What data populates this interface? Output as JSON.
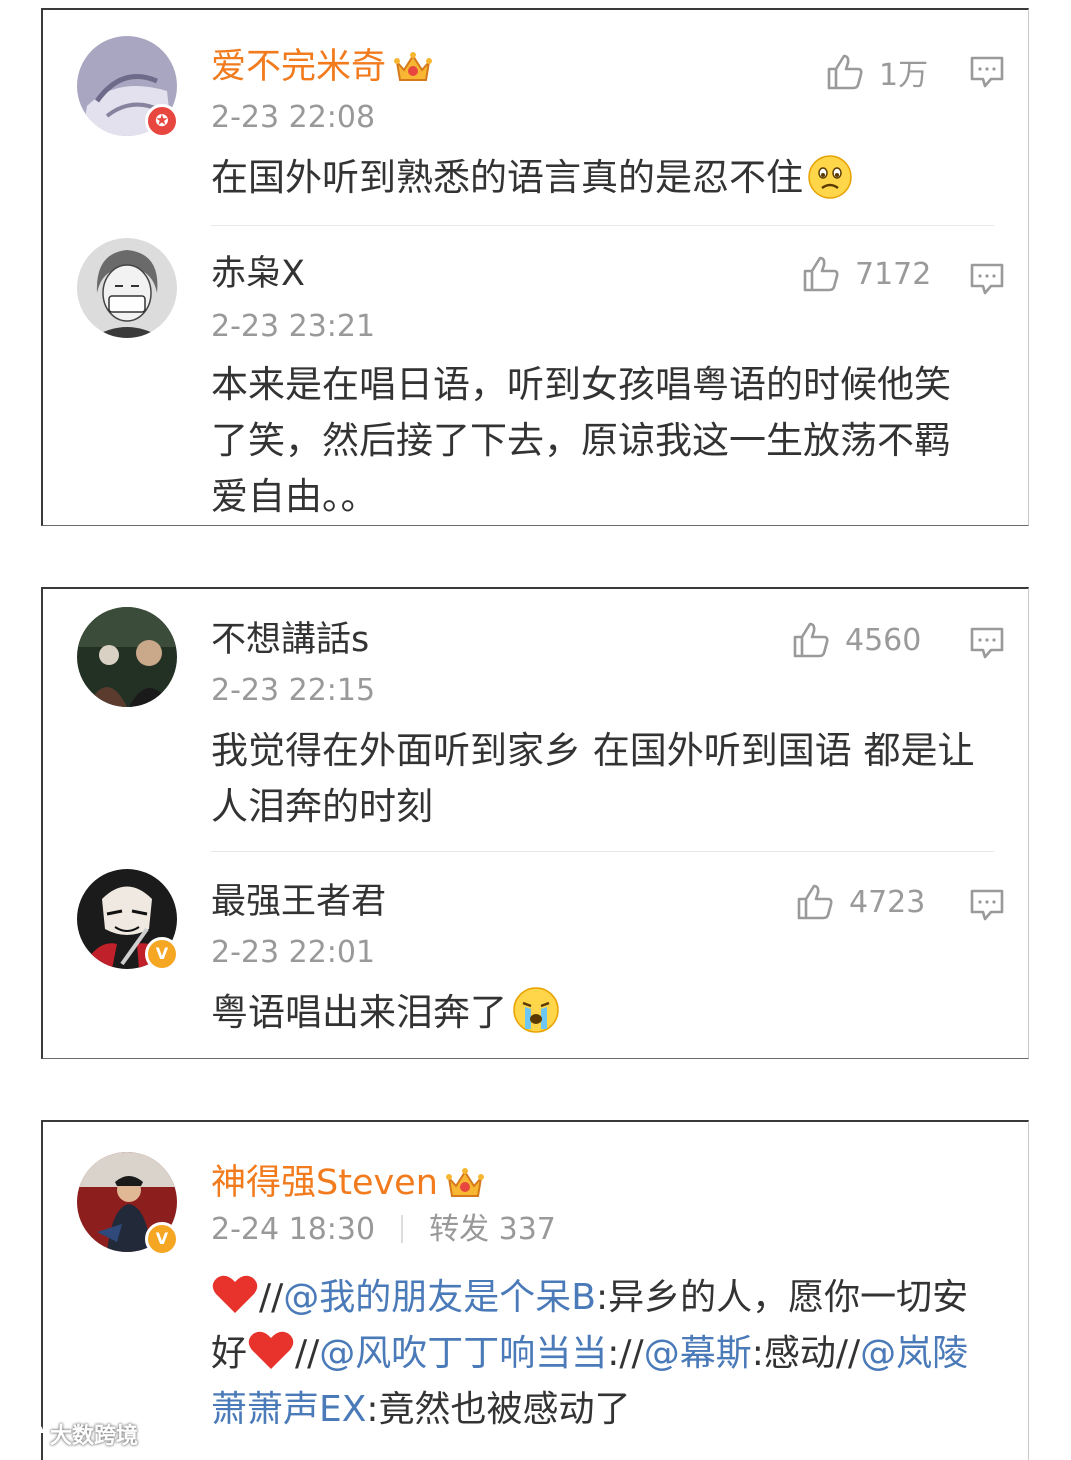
{
  "comments_group_1": {
    "c1": {
      "username": "爱不完米奇",
      "time": "2-23 22:08",
      "likes": "1万",
      "text": "在国外听到熟悉的语言真的是忍不住"
    },
    "c2": {
      "username": "赤枭X",
      "time": "2-23 23:21",
      "likes": "7172",
      "text": "本来是在唱日语，听到女孩唱粤语的时候他笑了笑，然后接了下去，原谅我这一生放荡不羁爱自由。。"
    }
  },
  "comments_group_2": {
    "c1": {
      "username": "不想講話s",
      "time": "2-23 22:15",
      "likes": "4560",
      "text": "我觉得在外面听到家乡 在国外听到国语 都是让人泪奔的时刻"
    },
    "c2": {
      "username": "最强王者君",
      "time": "2-23 22:01",
      "likes": "4723",
      "text": "粤语唱出来泪奔了"
    }
  },
  "repost": {
    "username": "神得强Steven",
    "time": "2-24 18:30",
    "repost_label": "转发 337",
    "seg1": "//",
    "mention1": "@我的朋友是个呆B",
    "seg2": ":异乡的人，愿你一切安好",
    "seg3": "//",
    "mention2": "@风吹丁丁响当当",
    "seg4": "://",
    "mention3": "@幕斯",
    "seg5": ":感动//",
    "mention4": "@岚陵萧萧声EX",
    "seg6": ":竟然也被感动了"
  },
  "watermark": "大数跨境",
  "colors": {
    "vip_name": "#f27b1e",
    "mention": "#4a7ab8",
    "meta_gray": "#999999",
    "verified_badge": "#f5a623",
    "red_badge": "#e8473f"
  },
  "icons": [
    "like-icon",
    "comment-icon",
    "crown-icon",
    "verified-badge-icon",
    "heart-icon",
    "sad-emoji-icon",
    "crying-emoji-icon"
  ]
}
